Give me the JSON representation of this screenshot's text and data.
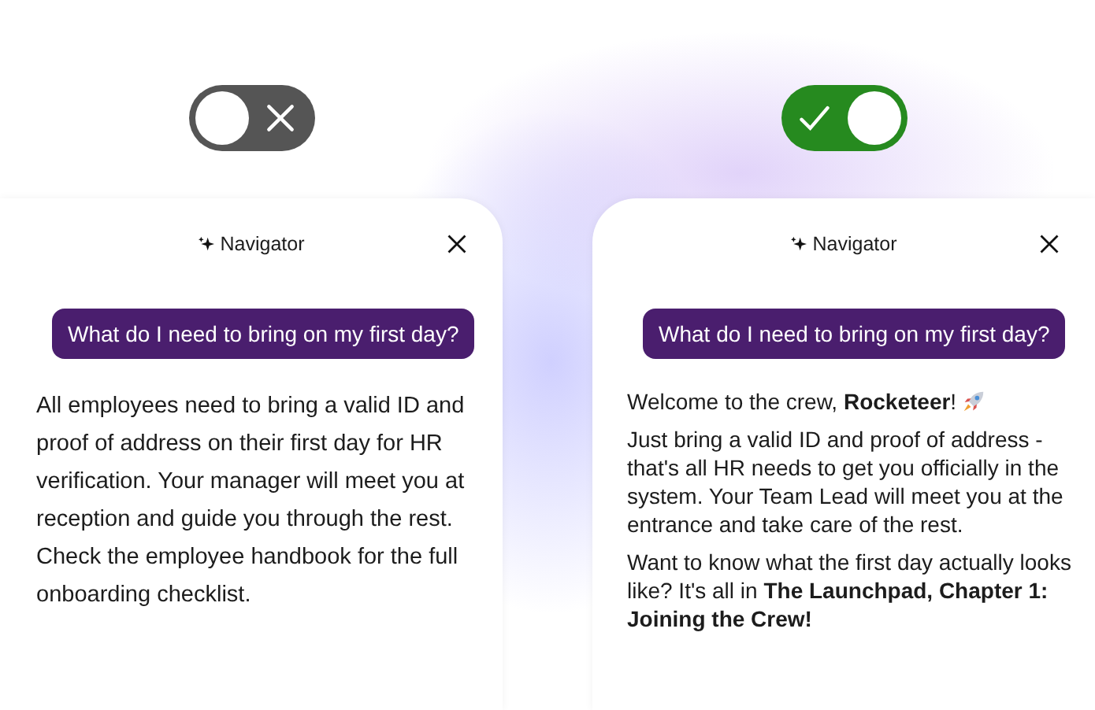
{
  "panels": [
    {
      "toggle": {
        "on": false
      },
      "card": {
        "title": "Navigator",
        "question": "What do I need to bring on my first day?",
        "answer": [
          {
            "kind": "text",
            "text": "All employees need to bring a valid ID and proof of address on their first day for HR verification. Your manager will meet you at reception and guide you through the rest. Check the employee handbook for the full onboarding checklist."
          }
        ]
      }
    },
    {
      "toggle": {
        "on": true
      },
      "card": {
        "title": "Navigator",
        "question": "What do I need to bring on my first day?",
        "answer": [
          {
            "kind": "greeting",
            "text": "Welcome to the crew, **Rocketeer**!"
          },
          {
            "kind": "text",
            "text": "Just bring a valid ID and proof of address - that's all HR needs to get you officially in the system. Your Team Lead will meet you at the entrance and take care of the rest."
          },
          {
            "kind": "text",
            "text": "Want to know what the first day actually looks like? It's all in **The Launchpad, Chapter 1: Joining the Crew!**"
          }
        ]
      }
    }
  ]
}
